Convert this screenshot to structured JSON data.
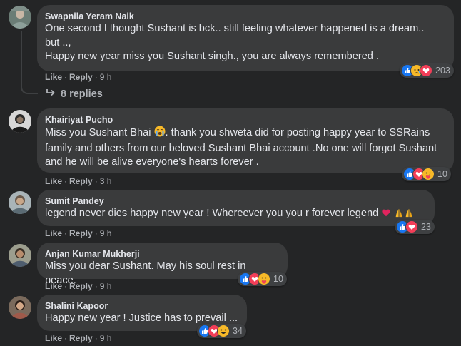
{
  "comments": [
    {
      "author": "Swapnila Yeram Naik",
      "text": "One second I thought Sushant is bck.. still feeling whatever happened is a dream..\nbut ..,\nHappy new year miss you Sushant singh., you are always remembered .",
      "actions": {
        "like": "Like",
        "reply": "Reply",
        "time": "9 h"
      },
      "reactions": {
        "icons": [
          "like-icon",
          "sad-icon",
          "love-icon"
        ],
        "count": "203"
      }
    },
    {
      "author": "Khairiyat Pucho",
      "text_before": "Miss you Sushant Bhai ",
      "text_after": ". thank you shweta did for posting happy year to SSRains family and others from our beloved Sushant Bhai account .No one will forgot Sushant and he will be alive everyone's hearts forever .",
      "inline_emoji": "crying-face-icon",
      "actions": {
        "like": "Like",
        "reply": "Reply",
        "time": "3 h"
      },
      "reactions": {
        "icons": [
          "like-icon",
          "love-icon",
          "care-icon"
        ],
        "count": "10"
      }
    },
    {
      "author": "Sumit Pandey",
      "text": "legend never dies happy new year ! Whereever you you r forever legend ",
      "inline_emojis": [
        "red-heart-icon",
        "folded-hands-icon",
        "folded-hands-icon"
      ],
      "actions": {
        "like": "Like",
        "reply": "Reply",
        "time": "9 h"
      },
      "reactions": {
        "icons": [
          "like-icon",
          "love-icon"
        ],
        "count": "23"
      }
    },
    {
      "author": "Anjan Kumar Mukherji",
      "text": "Miss you dear Sushant. May his soul rest in peace.",
      "actions": {
        "like": "Like",
        "reply": "Reply",
        "time": "9 h"
      },
      "reactions": {
        "icons": [
          "like-icon",
          "love-icon",
          "care-icon"
        ],
        "count": "10"
      }
    },
    {
      "author": "Shalini Kapoor",
      "text": "Happy new year ! Justice has to prevail ...",
      "actions": {
        "like": "Like",
        "reply": "Reply",
        "time": "9 h"
      },
      "reactions": {
        "icons": [
          "like-icon",
          "love-icon",
          "haha-icon"
        ],
        "count": "34"
      }
    }
  ],
  "replies": {
    "label": "8 replies",
    "icon": "reply-arrow-icon"
  },
  "colors": {
    "background": "#242526",
    "bubble": "#3a3b3c",
    "text": "#e4e6eb",
    "secondary": "#b0b3b8",
    "like_blue": "#1877f2",
    "love_red": "#f33e58",
    "emoji_yellow": "#f7b928"
  }
}
